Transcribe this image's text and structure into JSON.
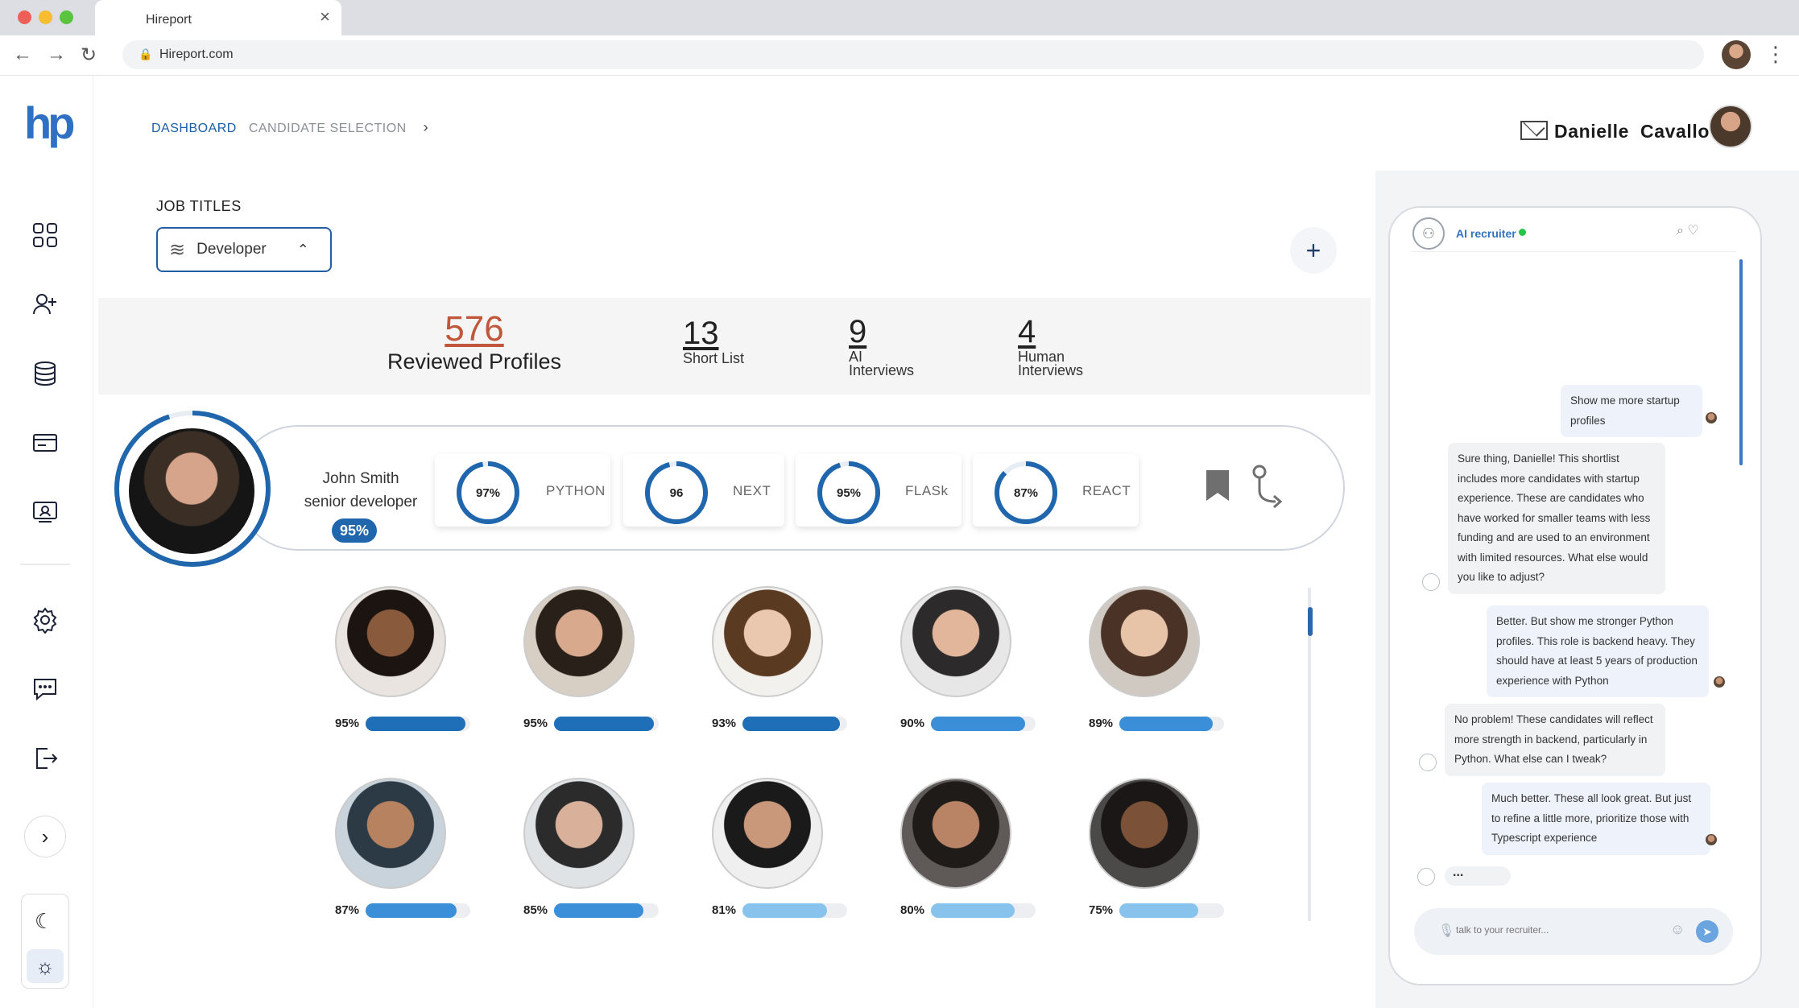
{
  "browser": {
    "tab_title": "Hireport",
    "url": "Hireport.com"
  },
  "logo": "hp",
  "breadcrumb": {
    "active": "DASHBOARD",
    "current": "CANDIDATE SELECTION"
  },
  "user": {
    "name": "Danielle  Cavallo"
  },
  "job": {
    "label": "JOB TITLES",
    "selected": "Developer"
  },
  "stats": {
    "reviewed": "576",
    "reviewed_label": "Reviewed Profiles",
    "shortlist": "13",
    "shortlist_label": "Short List",
    "ai": "9",
    "ai_label_1": "AI",
    "ai_label_2": "Interviews",
    "human": "4",
    "human_label_1": "Human",
    "human_label_2": "Interviews"
  },
  "featured": {
    "name": "John Smith",
    "role": "senior developer",
    "match": "95%",
    "match_value": 0.95,
    "skills": [
      {
        "value_label": "97%",
        "name": "PYTHON",
        "value": 0.97
      },
      {
        "value_label": "96",
        "name": "NEXT",
        "value": 0.96
      },
      {
        "value_label": "95%",
        "name": "FLASk",
        "value": 0.95
      },
      {
        "value_label": "87%",
        "name": "REACT",
        "value": 0.87
      }
    ]
  },
  "candidates": [
    {
      "pct": "95%",
      "value": 0.95
    },
    {
      "pct": "95%",
      "value": 0.95
    },
    {
      "pct": "93%",
      "value": 0.93
    },
    {
      "pct": "90%",
      "value": 0.9
    },
    {
      "pct": "89%",
      "value": 0.89
    },
    {
      "pct": "87%",
      "value": 0.87
    },
    {
      "pct": "85%",
      "value": 0.85
    },
    {
      "pct": "81%",
      "value": 0.81
    },
    {
      "pct": "80%",
      "value": 0.8
    },
    {
      "pct": "75%",
      "value": 0.75
    }
  ],
  "chat": {
    "title": "AI recruiter",
    "typing": "...",
    "input_placeholder": "talk to your recruiter...",
    "messages": [
      {
        "from": "user",
        "text": "Show me more startup profiles"
      },
      {
        "from": "bot",
        "text": "Sure thing, Danielle! This shortlist includes more candidates with startup experience. These are candidates who have worked for smaller teams with less funding and are used to an environment with limited resources. What else would you like to adjust?"
      },
      {
        "from": "user",
        "text": "Better. But show me stronger Python profiles. This role is backend heavy. They should have at least 5 years of production experience with Python"
      },
      {
        "from": "bot",
        "text": "No problem! These candidates will reflect more strength in backend, particularly in Python. What else can I tweak?"
      },
      {
        "from": "user",
        "text": "Much better. These all look great. But just to refine a little more, prioritize those with Typescript experience"
      }
    ]
  },
  "colors": {
    "accent": "#1f66ad",
    "stat_highlight": "#c0563a",
    "bar_dark": "#1f6fb8",
    "bar_mid": "#3a8fd8",
    "bar_light": "#87c3ec"
  }
}
